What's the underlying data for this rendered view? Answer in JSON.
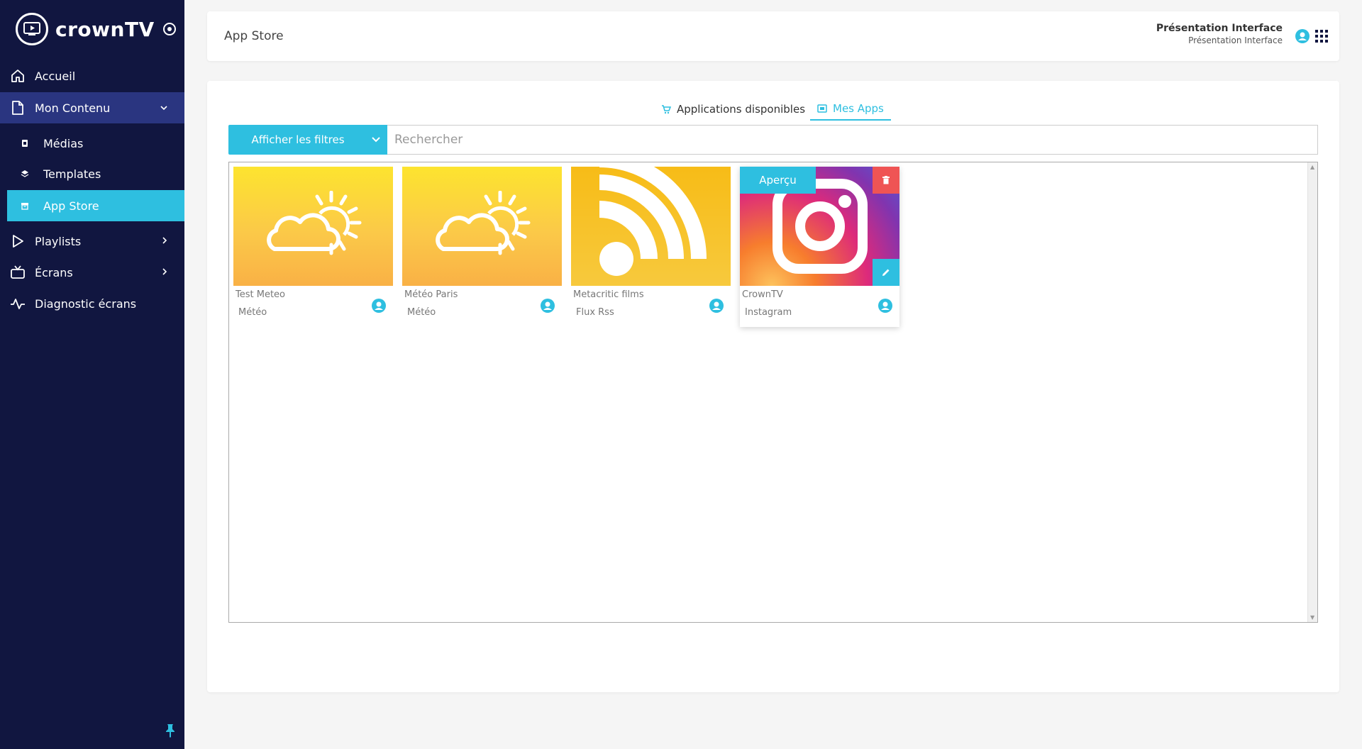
{
  "brand": {
    "name": "crownTV"
  },
  "sidebar": {
    "items": [
      {
        "label": "Accueil",
        "icon": "home-icon"
      },
      {
        "label": "Mon Contenu",
        "icon": "file-icon"
      },
      {
        "label": "Médias",
        "icon": "media-icon"
      },
      {
        "label": "Templates",
        "icon": "layers-icon"
      },
      {
        "label": "App Store",
        "icon": "box-icon"
      },
      {
        "label": "Playlists",
        "icon": "play-icon"
      },
      {
        "label": "Écrans",
        "icon": "tv-icon"
      },
      {
        "label": "Diagnostic écrans",
        "icon": "pulse-icon"
      }
    ]
  },
  "header": {
    "title": "App Store",
    "user_name": "Présentation Interface",
    "user_sub": "Présentation Interface"
  },
  "tabs": {
    "available": "Applications disponibles",
    "mine": "Mes Apps"
  },
  "filters": {
    "button_label": "Afficher les filtres",
    "search_placeholder": "Rechercher"
  },
  "apps": [
    {
      "title": "Test Meteo",
      "category": "Météo",
      "thumb": "weather-icon"
    },
    {
      "title": "Météo Paris",
      "category": "Météo",
      "thumb": "weather-icon"
    },
    {
      "title": "Metacritic films",
      "category": "Flux Rss",
      "thumb": "rss-icon"
    },
    {
      "title": "CrownTV",
      "category": "Instagram",
      "thumb": "instagram-icon",
      "preview_label": "Aperçu"
    }
  ],
  "colors": {
    "sidebar_bg": "#111640",
    "accent": "#2ebfe0",
    "open_group_bg": "#2a3580",
    "delete": "#ef5454"
  }
}
